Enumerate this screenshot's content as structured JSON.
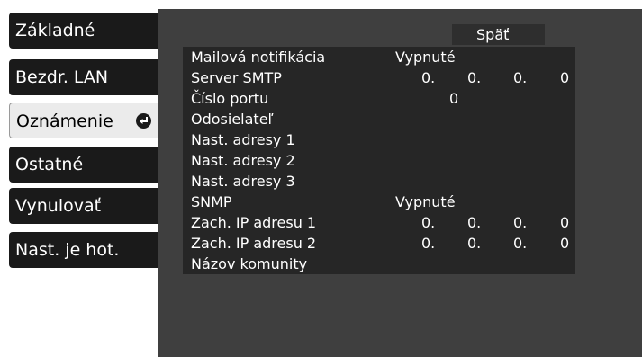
{
  "tabs": [
    {
      "label": "Základné"
    },
    {
      "label": "Bezdr. LAN"
    },
    {
      "label": "Oznámenie"
    },
    {
      "label": "Ostatné"
    },
    {
      "label": "Vynulovať"
    },
    {
      "label": "Nast. je hot."
    }
  ],
  "selected_tab": "Oznámenie",
  "back_label": "Späť",
  "rows": {
    "mail_notification": {
      "label": "Mailová notifikácia",
      "value": "Vypnuté"
    },
    "smtp_server": {
      "label": "Server SMTP",
      "octets": [
        "0.",
        "0.",
        "0.",
        "0"
      ]
    },
    "port_number": {
      "label": "Číslo portu",
      "value": "0"
    },
    "sender": {
      "label": "Odosielateľ"
    },
    "address_1": {
      "label": "Nast. adresy 1"
    },
    "address_2": {
      "label": "Nast. adresy 2"
    },
    "address_3": {
      "label": "Nast. adresy 3"
    },
    "snmp": {
      "label": "SNMP",
      "value": "Vypnuté"
    },
    "trap_ip_1": {
      "label": "Zach. IP adresu 1",
      "octets": [
        "0.",
        "0.",
        "0.",
        "0"
      ]
    },
    "trap_ip_2": {
      "label": "Zach. IP adresu 2",
      "octets": [
        "0.",
        "0.",
        "0.",
        "0"
      ]
    },
    "community_name": {
      "label": "Názov komunity"
    }
  },
  "icons": {
    "selected_tab_icon": "enter-icon"
  },
  "colors": {
    "tab_background": "#1a1a1a",
    "tab_selected_background": "#ebebeb",
    "panel_background": "#3f3f3f",
    "row_background": "#262626",
    "text": "#ffffff"
  }
}
